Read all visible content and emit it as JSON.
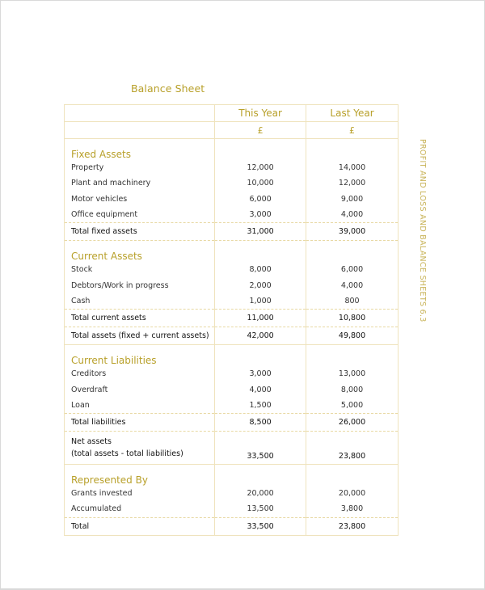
{
  "document": {
    "title": "Balance Sheet",
    "side_caption": "PROFIT AND LOSS AND BALANCE SHEETS 6.3",
    "colors": {
      "accent": "#b8a02a",
      "grid": "#efe3bd"
    }
  },
  "table": {
    "headers": [
      "",
      "This Year",
      "Last Year"
    ],
    "currency": [
      "",
      "£",
      "£"
    ],
    "fixed_assets": {
      "heading": "Fixed Assets",
      "rows": [
        {
          "label": "Property",
          "this_year": "12,000",
          "last_year": "14,000"
        },
        {
          "label": "Plant and machinery",
          "this_year": "10,000",
          "last_year": "12,000"
        },
        {
          "label": "Motor vehicles",
          "this_year": "6,000",
          "last_year": "9,000"
        },
        {
          "label": "Office equipment",
          "this_year": "3,000",
          "last_year": "4,000"
        }
      ],
      "total": {
        "label": "Total fixed assets",
        "this_year": "31,000",
        "last_year": "39,000"
      }
    },
    "current_assets": {
      "heading": "Current Assets",
      "rows": [
        {
          "label": "Stock",
          "this_year": "8,000",
          "last_year": "6,000"
        },
        {
          "label": "Debtors/Work in progress",
          "this_year": "2,000",
          "last_year": "4,000"
        },
        {
          "label": "Cash",
          "this_year": "1,000",
          "last_year": "800"
        }
      ],
      "total": {
        "label": "Total current assets",
        "this_year": "11,000",
        "last_year": "10,800"
      },
      "grand_total": {
        "label": "Total assets (fixed + current assets)",
        "this_year": "42,000",
        "last_year": "49,800"
      }
    },
    "current_liabilities": {
      "heading": "Current Liabilities",
      "rows": [
        {
          "label": "Creditors",
          "this_year": "3,000",
          "last_year": "13,000"
        },
        {
          "label": "Overdraft",
          "this_year": "4,000",
          "last_year": "8,000"
        },
        {
          "label": "Loan",
          "this_year": "1,500",
          "last_year": "5,000"
        }
      ],
      "total": {
        "label": "Total liabilities",
        "this_year": "8,500",
        "last_year": "26,000"
      },
      "net": {
        "label_line1": "Net assets",
        "label_line2": "(total assets - total liabilities)",
        "this_year": "33,500",
        "last_year": "23,800"
      }
    },
    "represented_by": {
      "heading": "Represented By",
      "rows": [
        {
          "label": "Grants invested",
          "this_year": "20,000",
          "last_year": "20,000"
        },
        {
          "label": "Accumulated",
          "this_year": "13,500",
          "last_year": "3,800"
        }
      ],
      "total": {
        "label": "Total",
        "this_year": "33,500",
        "last_year": "23,800"
      }
    }
  }
}
